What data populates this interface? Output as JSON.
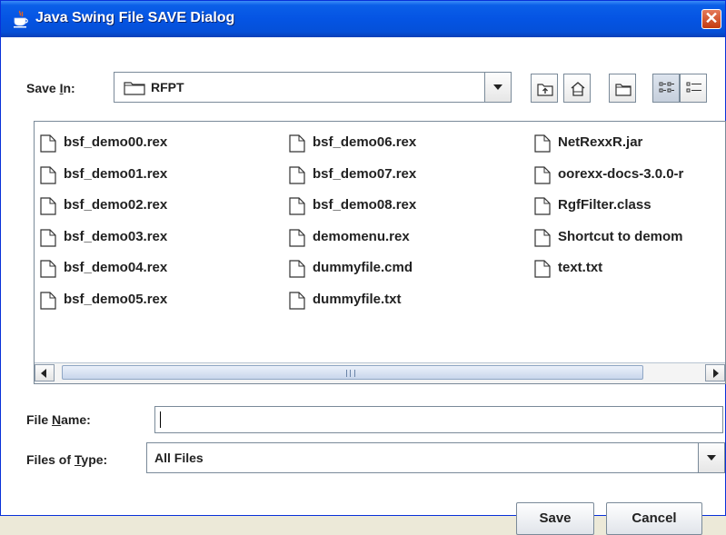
{
  "window": {
    "title": "Java Swing File SAVE Dialog",
    "close_glyph": "✕",
    "title_icon": "java-coffee-cup-icon"
  },
  "save_in": {
    "label_prefix": "Save ",
    "label_mnemonic": "I",
    "label_suffix": "n:",
    "folder_icon": "folder-icon",
    "value": "RFPT"
  },
  "toolbar": {
    "buttons": [
      {
        "name": "up-one-level-button",
        "icon": "folder-up-icon"
      },
      {
        "name": "home-button",
        "icon": "home-icon"
      },
      {
        "name": "new-folder-button",
        "icon": "new-folder-icon"
      },
      {
        "name": "list-view-button",
        "icon": "list-view-icon",
        "selected": true
      },
      {
        "name": "details-view-button",
        "icon": "details-view-icon"
      }
    ]
  },
  "files": {
    "columns": [
      [
        "bsf_demo00.rex",
        "bsf_demo01.rex",
        "bsf_demo02.rex",
        "bsf_demo03.rex",
        "bsf_demo04.rex",
        "bsf_demo05.rex"
      ],
      [
        "bsf_demo06.rex",
        "bsf_demo07.rex",
        "bsf_demo08.rex",
        "demomenu.rex",
        "dummyfile.cmd",
        "dummyfile.txt"
      ],
      [
        "NetRexxR.jar",
        "oorexx-docs-3.0.0-r",
        "RgfFilter.class",
        "Shortcut to demom",
        "text.txt"
      ]
    ],
    "file_icon": "file-icon"
  },
  "file_name": {
    "label_prefix": "File ",
    "label_mnemonic": "N",
    "label_suffix": "ame:",
    "value": ""
  },
  "file_type": {
    "label_prefix": "Files of ",
    "label_mnemonic": "T",
    "label_suffix": "ype:",
    "value": "All Files"
  },
  "buttons": {
    "save": "Save",
    "cancel": "Cancel"
  },
  "colors": {
    "titlebar": "#0554e3",
    "dialog_bg": "#ffffff",
    "border": "#7a8a99"
  }
}
